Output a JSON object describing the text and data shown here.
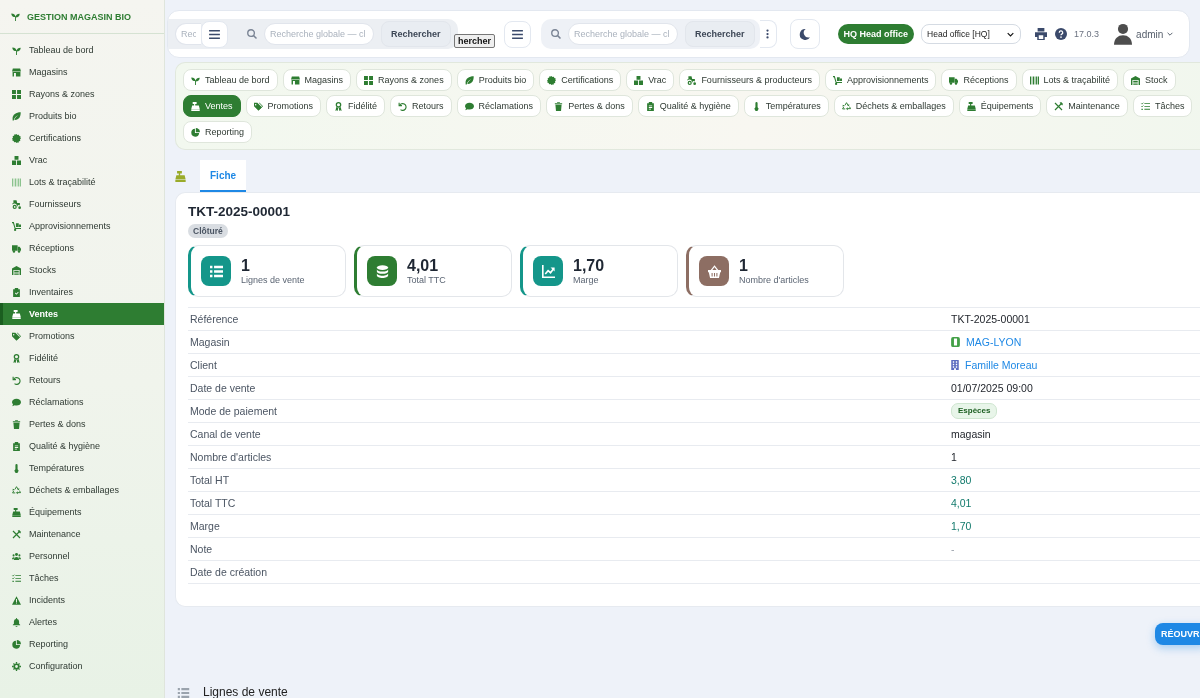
{
  "sidebar": {
    "title": "GESTION MAGASIN BIO",
    "items": [
      {
        "label": "Tableau de bord",
        "selected": false
      },
      {
        "label": "Magasins",
        "selected": false
      },
      {
        "label": "Rayons & zones",
        "selected": false
      },
      {
        "label": "Produits bio",
        "selected": false
      },
      {
        "label": "Certifications",
        "selected": false
      },
      {
        "label": "Vrac",
        "selected": false
      },
      {
        "label": "Lots & traçabilité",
        "selected": false
      },
      {
        "label": "Fournisseurs",
        "selected": false
      },
      {
        "label": "Approvisionnements",
        "selected": false
      },
      {
        "label": "Réceptions",
        "selected": false
      },
      {
        "label": "Stocks",
        "selected": false
      },
      {
        "label": "Inventaires",
        "selected": false
      },
      {
        "label": "Ventes",
        "selected": true
      },
      {
        "label": "Promotions",
        "selected": false
      },
      {
        "label": "Fidélité",
        "selected": false
      },
      {
        "label": "Retours",
        "selected": false
      },
      {
        "label": "Réclamations",
        "selected": false
      },
      {
        "label": "Pertes & dons",
        "selected": false
      },
      {
        "label": "Qualité & hygiène",
        "selected": false
      },
      {
        "label": "Températures",
        "selected": false
      },
      {
        "label": "Déchets & emballages",
        "selected": false
      },
      {
        "label": "Équipements",
        "selected": false
      },
      {
        "label": "Maintenance",
        "selected": false
      },
      {
        "label": "Personnel",
        "selected": false
      },
      {
        "label": "Tâches",
        "selected": false
      },
      {
        "label": "Incidents",
        "selected": false
      },
      {
        "label": "Alertes",
        "selected": false
      },
      {
        "label": "Reporting",
        "selected": false
      },
      {
        "label": "Configuration",
        "selected": false
      }
    ]
  },
  "topbar": {
    "covered_search": {
      "placeholder": "Rec"
    },
    "search_bars": [
      {
        "placeholder": "Recherche globale — cl",
        "button": "Rechercher"
      },
      {
        "placeholder": "Recherche globale — cl",
        "button": "Rechercher"
      }
    ],
    "stray_button": "hercher",
    "office_badge": "HQ Head office",
    "office_select": "Head office [HQ]",
    "version": "17.0.3",
    "user": "admin"
  },
  "module_nav": {
    "items": [
      {
        "label": "Tableau de bord",
        "selected": false
      },
      {
        "label": "Magasins",
        "selected": false
      },
      {
        "label": "Rayons & zones",
        "selected": false
      },
      {
        "label": "Produits bio",
        "selected": false
      },
      {
        "label": "Certifications",
        "selected": false
      },
      {
        "label": "Vrac",
        "selected": false
      },
      {
        "label": "Fournisseurs & producteurs",
        "selected": false
      },
      {
        "label": "Approvisionnements",
        "selected": false
      },
      {
        "label": "Réceptions",
        "selected": false
      },
      {
        "label": "Lots & traçabilité",
        "selected": false
      },
      {
        "label": "Stock",
        "selected": false
      },
      {
        "label": "Ventes",
        "selected": true
      },
      {
        "label": "Promotions",
        "selected": false
      },
      {
        "label": "Fidélité",
        "selected": false
      },
      {
        "label": "Retours",
        "selected": false
      },
      {
        "label": "Réclamations",
        "selected": false
      },
      {
        "label": "Pertes & dons",
        "selected": false
      },
      {
        "label": "Qualité & hygiène",
        "selected": false
      },
      {
        "label": "Températures",
        "selected": false
      },
      {
        "label": "Déchets & emballages",
        "selected": false
      },
      {
        "label": "Équipements",
        "selected": false
      },
      {
        "label": "Maintenance",
        "selected": false
      },
      {
        "label": "Tâches",
        "selected": false
      },
      {
        "label": "Reporting",
        "selected": false
      }
    ]
  },
  "tabs": [
    {
      "label": "Fiche",
      "selected": true
    }
  ],
  "record": {
    "title": "TKT-2025-00001",
    "status": "Clôturé",
    "stats": [
      {
        "value": "1",
        "label": "Lignes de vente",
        "color": "#14968a"
      },
      {
        "value": "4,01",
        "label": "Total TTC",
        "color": "#2e7d32"
      },
      {
        "value": "1,70",
        "label": "Marge",
        "color": "#14968a"
      },
      {
        "value": "1",
        "label": "Nombre d'articles",
        "color": "#8d6e63"
      }
    ],
    "fields": [
      {
        "label": "Référence",
        "value": "TKT-2025-00001",
        "kind": "text"
      },
      {
        "label": "Magasin",
        "value": "MAG-LYON",
        "kind": "store"
      },
      {
        "label": "Client",
        "value": "Famille Moreau",
        "kind": "client"
      },
      {
        "label": "Date de vente",
        "value": "01/07/2025 09:00",
        "kind": "text"
      },
      {
        "label": "Mode de paiement",
        "value": "Espèces",
        "kind": "badge"
      },
      {
        "label": "Canal de vente",
        "value": "magasin",
        "kind": "text"
      },
      {
        "label": "Nombre d'articles",
        "value": "1",
        "kind": "text"
      },
      {
        "label": "Total HT",
        "value": "3,80",
        "kind": "amount"
      },
      {
        "label": "Total TTC",
        "value": "4,01",
        "kind": "amount"
      },
      {
        "label": "Marge",
        "value": "1,70",
        "kind": "amount"
      },
      {
        "label": "Note",
        "value": "-",
        "kind": "muted"
      },
      {
        "label": "Date de création"
      }
    ]
  },
  "action_button": "RÉOUVR",
  "section": {
    "title": "Lignes de vente"
  }
}
